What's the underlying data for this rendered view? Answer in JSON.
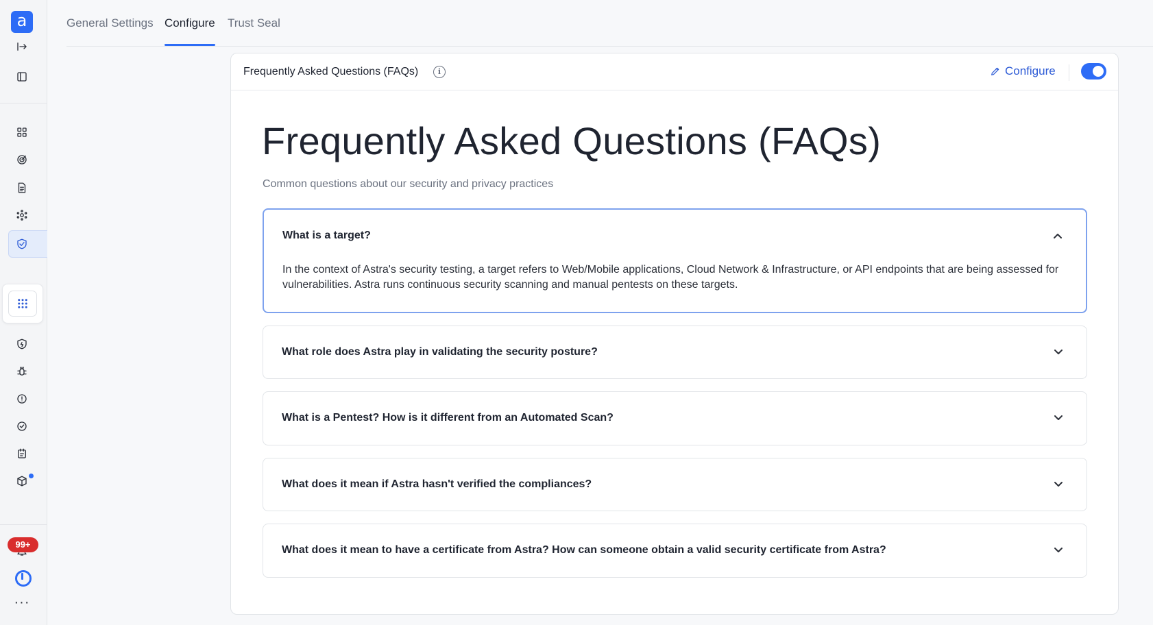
{
  "sidebar": {
    "logo": "a",
    "icons": [
      "expand-icon",
      "panel-icon",
      "dashboard-icon",
      "target-icon",
      "document-icon",
      "integrations-icon",
      "trust-center-icon",
      "apps-grid-icon",
      "shield-icon",
      "bug-icon",
      "alert-icon",
      "check-circle-icon",
      "calendar-icon",
      "package-icon",
      "bell-icon",
      "power-icon",
      "more-icon"
    ],
    "notifications_badge": "99+",
    "more": "···"
  },
  "tabs": [
    {
      "label": "General Settings",
      "active": false
    },
    {
      "label": "Configure",
      "active": true
    },
    {
      "label": "Trust Seal",
      "active": false
    }
  ],
  "card": {
    "title": "Frequently Asked Questions (FAQs)",
    "info": "i",
    "configure_label": "Configure",
    "toggle_on": true,
    "accent_color": "#2d6cf6"
  },
  "faq": {
    "heading": "Frequently Asked Questions (FAQs)",
    "subheading": "Common questions about our security and privacy practices",
    "items": [
      {
        "question": "What is a target?",
        "expanded": true,
        "answer": "In the context of Astra's security testing, a target refers to Web/Mobile applications, Cloud Network & Infrastructure, or API endpoints that are being assessed for vulnerabilities. Astra runs continuous security scanning and manual pentests on these targets."
      },
      {
        "question": "What role does Astra play in validating the security posture?",
        "expanded": false
      },
      {
        "question": "What is a Pentest? How is it different from an Automated Scan?",
        "expanded": false
      },
      {
        "question": "What does it mean if Astra hasn't verified the compliances?",
        "expanded": false
      },
      {
        "question": "What does it mean to have a certificate from Astra? How can someone obtain a valid security certificate from Astra?",
        "expanded": false
      }
    ]
  }
}
